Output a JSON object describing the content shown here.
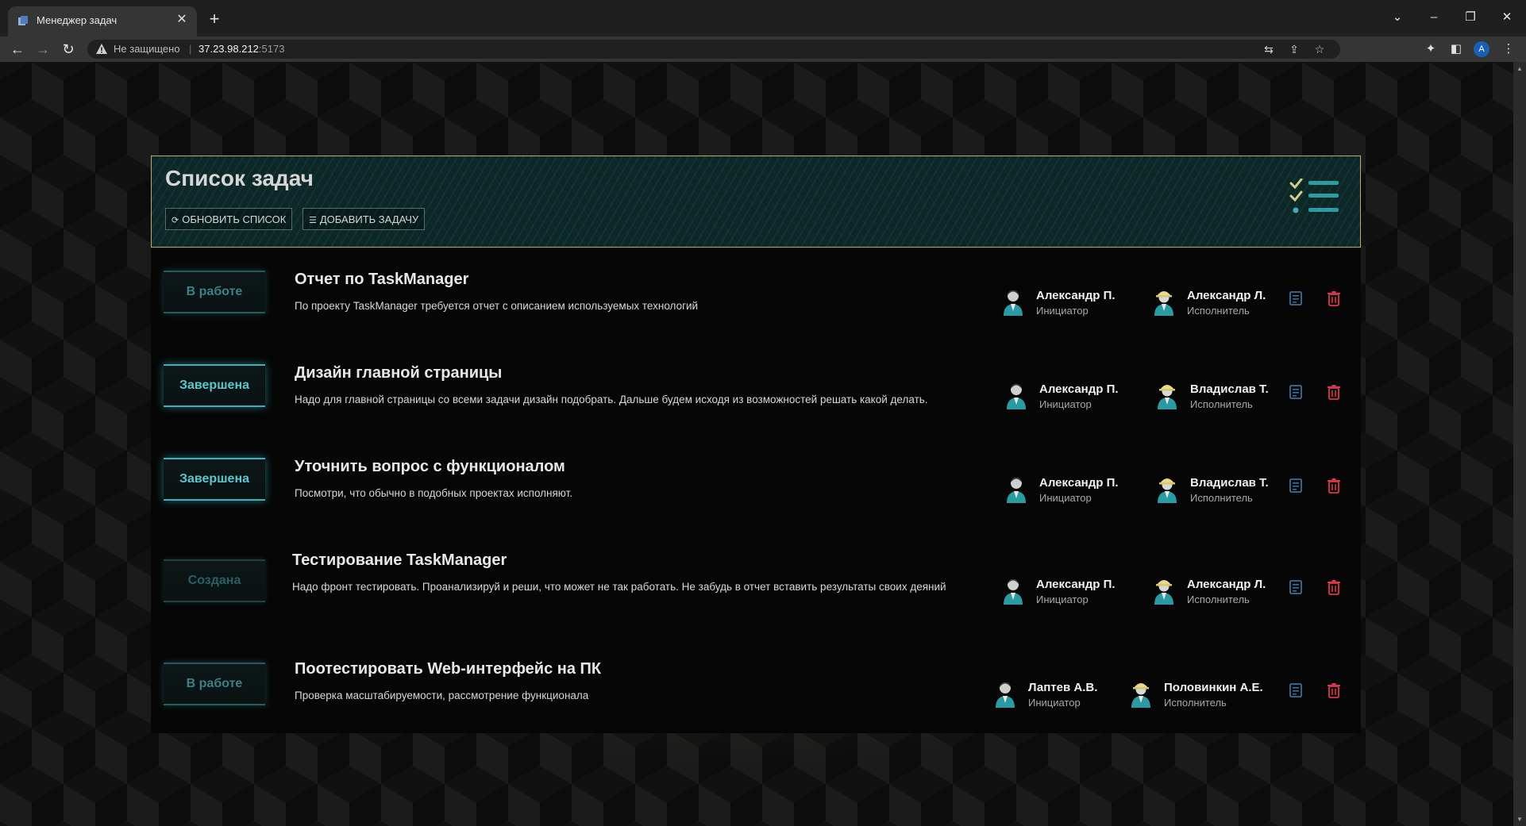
{
  "browser": {
    "tab_title": "Менеджер задач",
    "security_label": "Не защищено",
    "separator": "|",
    "url_host": "37.23.98.212",
    "url_port": ":5173",
    "profile_initial": "A"
  },
  "page": {
    "title": "Список задач",
    "refresh_label": "ОБНОВИТЬ СПИСОК",
    "add_label": "ДОБАВИТЬ ЗАДАЧУ"
  },
  "tasks": [
    {
      "status": "В работе",
      "title": "Отчет по TaskManager",
      "description": "По проекту TaskManager требуется отчет с описанием используемых технологий",
      "initiator": "Александр П.",
      "initiator_role": "Инициатор",
      "executor": "Александр Л.",
      "executor_role": "Исполнитель"
    },
    {
      "status": "Завершена",
      "title": "Дизайн главной страницы",
      "description": "Надо для главной страницы со всеми задачи дизайн подобрать. Дальше будем исходя из возможностей решать какой делать.",
      "initiator": "Александр П.",
      "initiator_role": "Инициатор",
      "executor": "Владислав Т.",
      "executor_role": "Исполнитель"
    },
    {
      "status": "Завершена",
      "title": "Уточнить вопрос с функционалом",
      "description": "Посмотри, что обычно в подобных проектах исполняют.",
      "initiator": "Александр П.",
      "initiator_role": "Инициатор",
      "executor": "Владислав Т.",
      "executor_role": "Исполнитель"
    },
    {
      "status": "Создана",
      "title": "Тестирование TaskManager",
      "description": "Надо фронт тестировать. Проанализируй и реши, что может не так работать. Не забудь в отчет вставить результаты своих деяний",
      "initiator": "Александр П.",
      "initiator_role": "Инициатор",
      "executor": "Александр Л.",
      "executor_role": "Исполнитель"
    },
    {
      "status": "В работе",
      "title": "Поотестировать Web-интерфейс на ПК",
      "description": "Проверка масштабируемости, рассмотрение функционала",
      "initiator": "Лаптев А.В.",
      "initiator_role": "Инициатор",
      "executor": "Половинкин А.Е.",
      "executor_role": "Исполнитель"
    }
  ],
  "colors": {
    "accent_teal": "#3fb0bb",
    "header_border": "#b8ad6e",
    "delete_red": "#d8364d",
    "edit_blue": "#3a6f9a"
  },
  "icons": {
    "refresh": "refresh-icon",
    "add": "add-task-icon",
    "edit": "edit-icon",
    "delete": "trash-icon",
    "initiator_avatar": "user-avatar-icon",
    "executor_avatar": "worker-avatar-icon",
    "header_graphic": "checklist-icon"
  }
}
